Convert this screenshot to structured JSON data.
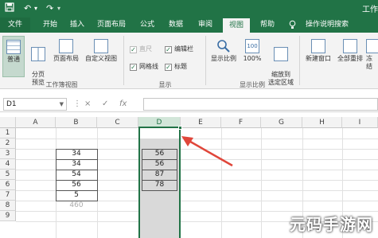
{
  "app": {
    "title": "工作",
    "quick_access": [
      "save",
      "undo",
      "redo",
      "customize"
    ]
  },
  "ribbon_tabs": [
    {
      "label": "文件",
      "state": "file"
    },
    {
      "label": "开始"
    },
    {
      "label": "插入"
    },
    {
      "label": "页面布局"
    },
    {
      "label": "公式"
    },
    {
      "label": "数据"
    },
    {
      "label": "审阅"
    },
    {
      "label": "视图",
      "state": "active"
    },
    {
      "label": "帮助"
    },
    {
      "label": "操作说明搜索"
    }
  ],
  "ribbon": {
    "workbook_views": {
      "label": "工作簿视图",
      "buttons": [
        "普通",
        "分页\n预览",
        "页面布局",
        "自定义视图"
      ]
    },
    "show": {
      "label": "显示",
      "checkboxes": [
        {
          "label": "直尺",
          "checked": true,
          "disabled": true
        },
        {
          "label": "编辑栏",
          "checked": true
        },
        {
          "label": "网格线",
          "checked": true
        },
        {
          "label": "标题",
          "checked": true
        }
      ]
    },
    "zoom": {
      "label": "显示比例",
      "buttons": [
        "显示比例",
        "100%",
        "缩放到\n选定区域"
      ]
    },
    "window": {
      "buttons": [
        "新建窗口",
        "全部重排",
        "冻结"
      ]
    }
  },
  "formula_bar": {
    "name_box": "D1",
    "fx_symbols": [
      "⋮",
      "×",
      "✓",
      "fx"
    ],
    "value": ""
  },
  "sheet": {
    "columns": [
      "A",
      "B",
      "C",
      "D",
      "E",
      "F",
      "G",
      "H",
      "I"
    ],
    "rows": [
      "1",
      "2",
      "3",
      "4",
      "5",
      "6",
      "7",
      "8",
      "9"
    ],
    "selected_column": "D",
    "column_b": [
      "34",
      "34",
      "54",
      "56",
      "5",
      "460"
    ],
    "column_d": [
      "56",
      "56",
      "87",
      "78"
    ]
  },
  "colors": {
    "accent": "#217346",
    "arrow": "#e0463a",
    "selection_fill": "#d9d9d9"
  },
  "watermark": "元码手游网"
}
